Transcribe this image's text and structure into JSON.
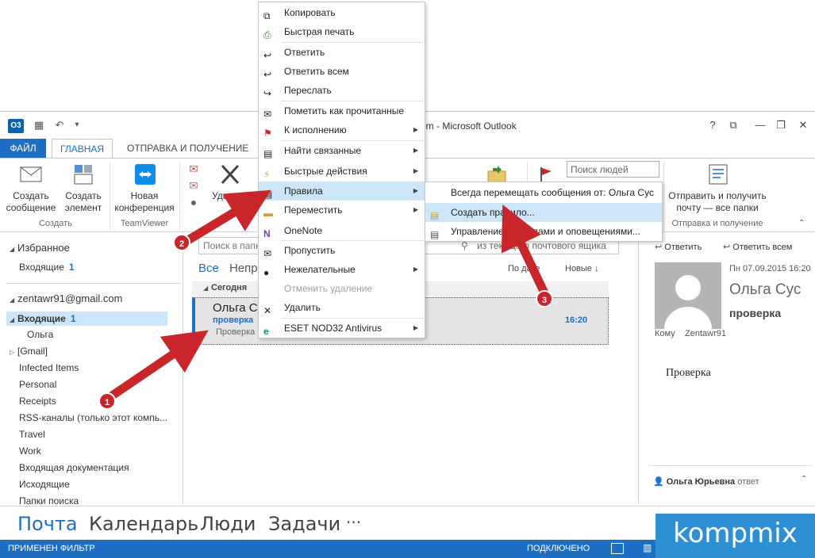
{
  "window": {
    "title": "om - Microsoft Outlook",
    "app_logo": "O3",
    "controls": [
      "?",
      "⧉",
      "—",
      "❐",
      "✕"
    ]
  },
  "tabs": {
    "file": "ФАЙЛ",
    "home": "ГЛАВНАЯ",
    "send_receive": "ОТПРАВКА И ПОЛУЧЕНИЕ"
  },
  "ribbon": {
    "new_message": "Создать\nсообщение",
    "new_items": "Создать\nэлемент",
    "new_group_label": "Создать",
    "teamviewer_btn": "Новая\nконференция",
    "teamviewer_label": "TeamViewer",
    "delete_label": "Удалить",
    "search_people_placeholder": "Поиск людей",
    "send_receive_all": "Отправить и получить\nпочту — все папки",
    "send_receive_label": "Отправка и получение"
  },
  "nav": {
    "favorites": "Избранное",
    "fav_inbox": "Входящие",
    "fav_inbox_count": "1",
    "account": "zentawr91@gmail.com",
    "inbox": "Входящие",
    "inbox_count": "1",
    "folders": [
      "Ольга",
      "[Gmail]",
      "Infected Items",
      "Personal",
      "Receipts",
      "RSS-каналы (только этот компь...",
      "Travel",
      "Work",
      "Входящая документация",
      "Исходящие",
      "Папки поиска"
    ]
  },
  "list": {
    "search_placeholder": "Поиск в папке",
    "search_scope": "из текущего почтового ящика",
    "filter_all": "Все",
    "filter_unread": "Непр",
    "sort_by": "По дате",
    "sort_order": "Новые",
    "group_today": "Сегодня",
    "message": {
      "from": "Ольга Сус",
      "subject": "проверка",
      "preview": "Проверка",
      "time": "16:20"
    }
  },
  "reading": {
    "reply": "Ответить",
    "reply_all": "Ответить всем",
    "date": "Пн 07.09.2015 16:20",
    "sender": "Ольга Сус",
    "subject": "проверка",
    "to_label": "Кому",
    "to_value": "Zentawr91",
    "body": "Проверка",
    "people_name": "Ольга Юрьевна",
    "people_action": "ответ"
  },
  "bottom_nav": {
    "mail": "Почта",
    "calendar": "Календарь",
    "people": "Люди",
    "tasks": "Задачи",
    "more": "···"
  },
  "status": {
    "filter": "ПРИМЕНЕН ФИЛЬТР",
    "connection": "ПОДКЛЮЧЕНО"
  },
  "context_menu": {
    "items": [
      "Копировать",
      "Быстрая печать",
      "Ответить",
      "Ответить всем",
      "Переслать",
      "Пометить как прочитанные",
      "К исполнению",
      "Найти связанные",
      "Быстрые действия",
      "Правила",
      "Переместить",
      "OneNote",
      "Пропустить",
      "Нежелательные",
      "Отменить удаление",
      "Удалить",
      "ESET NOD32 Antivirus"
    ]
  },
  "submenu": {
    "items": [
      "Всегда перемещать сообщения от: Ольга Сус",
      "Создать правило...",
      "Управление правилами и оповещениями..."
    ]
  },
  "annotations": {
    "badge1": "1",
    "badge2": "2",
    "badge3": "3"
  },
  "watermark": "kompmix",
  "colors": {
    "accent": "#1e6fc3",
    "selection": "#cde6f7",
    "annotation": "#c8262a"
  }
}
